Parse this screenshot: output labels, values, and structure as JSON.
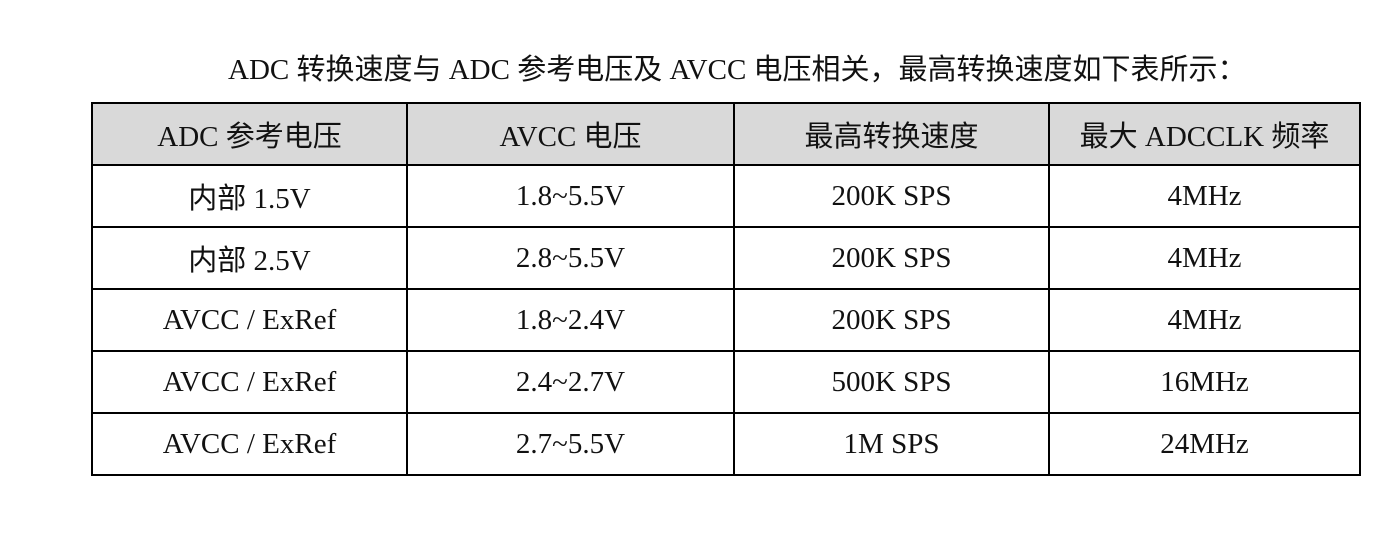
{
  "intro_text": "ADC 转换速度与 ADC 参考电压及 AVCC 电压相关，最高转换速度如下表所示：",
  "table": {
    "headers": [
      "ADC 参考电压",
      "AVCC 电压",
      "最高转换速度",
      "最大 ADCCLK 频率"
    ],
    "rows": [
      [
        "内部 1.5V",
        "1.8~5.5V",
        "200K SPS",
        "4MHz"
      ],
      [
        "内部 2.5V",
        "2.8~5.5V",
        "200K SPS",
        "4MHz"
      ],
      [
        "AVCC / ExRef",
        "1.8~2.4V",
        "200K SPS",
        "4MHz"
      ],
      [
        "AVCC / ExRef",
        "2.4~2.7V",
        "500K SPS",
        "16MHz"
      ],
      [
        "AVCC / ExRef",
        "2.7~5.5V",
        "1M SPS",
        "24MHz"
      ]
    ]
  },
  "colors": {
    "header_background": "#d9d9d9",
    "border": "#000000",
    "text": "#111111"
  }
}
